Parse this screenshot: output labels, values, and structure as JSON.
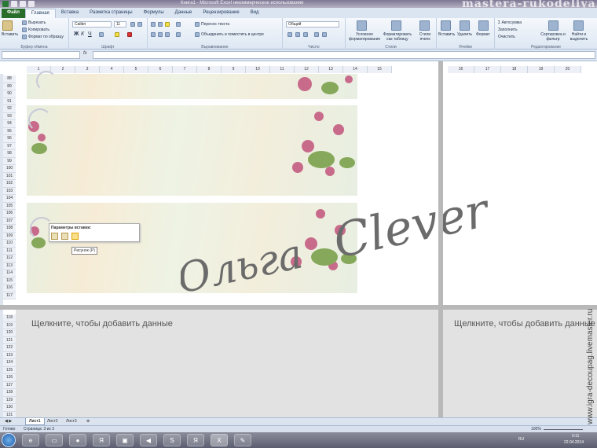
{
  "window": {
    "title": "Книга1 - Microsoft Excel некоммерческое использование",
    "watermark_top": "mastera-rukodeliya.ru"
  },
  "tabs": [
    {
      "label": "Файл"
    },
    {
      "label": "Главная"
    },
    {
      "label": "Вставка"
    },
    {
      "label": "Разметка страницы"
    },
    {
      "label": "Формулы"
    },
    {
      "label": "Данные"
    },
    {
      "label": "Рецензирование"
    },
    {
      "label": "Вид"
    }
  ],
  "ribbon": {
    "clipboard": {
      "paste": "Вставить",
      "cut": "Вырезать",
      "copy": "Копировать",
      "format_painter": "Формат по образцу",
      "group": "Буфер обмена"
    },
    "font": {
      "name": "Calibri",
      "size": "11",
      "group": "Шрифт"
    },
    "alignment": {
      "wrap": "Перенос текста",
      "merge": "Объединить и поместить в центре",
      "group": "Выравнивание"
    },
    "number": {
      "format": "Общий",
      "group": "Число"
    },
    "styles": {
      "conditional": "Условное форматирование",
      "as_table": "Форматировать как таблицу",
      "cell_styles": "Стили ячеек",
      "group": "Стили"
    },
    "cells": {
      "insert": "Вставить",
      "delete": "Удалить",
      "format": "Формат",
      "group": "Ячейки"
    },
    "editing": {
      "autosum": "Автосумма",
      "fill": "Заполнить",
      "clear": "Очистить",
      "sort": "Сортировка и фильтр",
      "find": "Найти и выделить",
      "group": "Редактирование"
    }
  },
  "formula_bar": {
    "fx": "fx",
    "name_box": "",
    "value": ""
  },
  "columns_left": [
    "1",
    "2",
    "3",
    "4",
    "5",
    "6",
    "7",
    "8",
    "9",
    "10",
    "11",
    "12",
    "13",
    "14",
    "15"
  ],
  "columns_right": [
    "16",
    "17",
    "18",
    "19",
    "20"
  ],
  "rows_upper": [
    "88",
    "89",
    "90",
    "91",
    "92",
    "93",
    "94",
    "95",
    "96",
    "97",
    "98",
    "99",
    "100",
    "101",
    "102",
    "103",
    "104",
    "105",
    "106",
    "107",
    "108",
    "109",
    "110",
    "111",
    "112",
    "113",
    "114",
    "115",
    "116",
    "117"
  ],
  "rows_lower": [
    "118",
    "119",
    "120",
    "121",
    "122",
    "123",
    "124",
    "125",
    "126",
    "127",
    "128",
    "129",
    "130",
    "131"
  ],
  "paste_options": {
    "title": "Параметры вставки:",
    "tooltip": "Рисунок (Р)"
  },
  "watermark": {
    "line1": "Ольга",
    "line2": "Clever",
    "side": "www.igra-decoupag.livemaster.ru"
  },
  "placeholders": {
    "left": "Щелкните, чтобы добавить данные",
    "right": "Щелкните, чтобы добавить данные"
  },
  "sheet_tabs": [
    "Лист1",
    "Лист2",
    "Лист3"
  ],
  "status": {
    "ready": "Готово",
    "page": "Страница: 3 из 3",
    "zoom": "100%"
  },
  "taskbar": {
    "lang": "RU",
    "time": "0:11",
    "date": "22.04.2014"
  },
  "colors": {
    "accent": "#2a6e2c",
    "ribbon": "#dde7f3",
    "watermark": "#6b6b6b"
  }
}
